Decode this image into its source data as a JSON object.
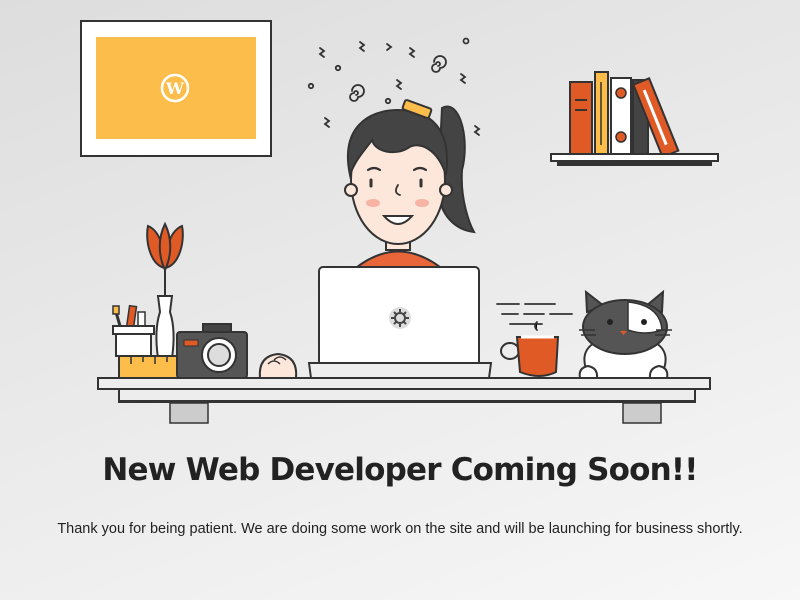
{
  "page": {
    "heading": "New Web Developer Coming Soon!!",
    "message": "Thank you for being patient. We are doing some work on the site and will be launching for business shortly."
  },
  "illustration": {
    "frame_logo": "W",
    "icons": {
      "frame": "wordpress-logo-icon",
      "laptop": "gear-icon"
    }
  },
  "colors": {
    "ink": "#333333",
    "accent_orange": "#e05a26",
    "accent_yellow": "#fdbd4a",
    "skin": "#fde6da",
    "desk": "#ededed",
    "text": "#222222"
  }
}
